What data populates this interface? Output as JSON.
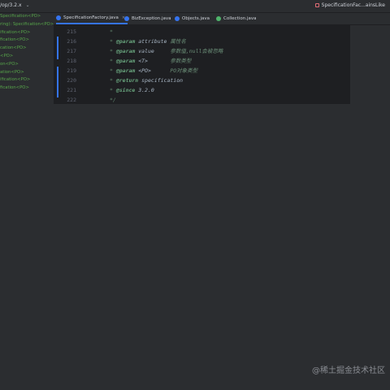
{
  "titlebar": {
    "branch": "/op/3.2.x",
    "branch_chevron": "⌄",
    "run_config": "SpecificationFac...ainsLike"
  },
  "left_panel": {
    "items": [
      "Specification<PO>",
      "ring): Specification<PO>",
      "ification<PO>",
      "fication<PO>",
      "cation<PO>",
      "<PO>",
      "on<PO>",
      "ation<PO>",
      "ification<PO>",
      "fication<PO>"
    ]
  },
  "tabs": [
    {
      "label": "SpecificationFactory.java",
      "icon": "class-icon",
      "color": "#3574f0",
      "active": true
    },
    {
      "label": "BizException.java",
      "icon": "class-icon",
      "color": "#3574f0"
    },
    {
      "label": "Objects.java",
      "icon": "class-icon",
      "color": "#3574f0"
    },
    {
      "label": "Collection.java",
      "icon": "interface-icon",
      "color": "#4fb56b"
    }
  ],
  "tab_close": "×",
  "editor": {
    "lines": [
      {
        "num": "215",
        "star": "*",
        "tag": "",
        "param": "",
        "desc": ""
      },
      {
        "num": "216",
        "star": "* ",
        "tag": "@param",
        "param": " attribute ",
        "desc": "属性名"
      },
      {
        "num": "217",
        "star": "* ",
        "tag": "@param",
        "param": " value     ",
        "desc": "参数值,null会被忽略"
      },
      {
        "num": "218",
        "star": "* ",
        "tag": "@param",
        "param": " <T>       ",
        "desc": "参数类型"
      },
      {
        "num": "219",
        "star": "* ",
        "tag": "@param",
        "param": " <PO>      ",
        "desc": "PO对象类型"
      },
      {
        "num": "220",
        "star": "* ",
        "tag": "@return",
        "param": " specification",
        "desc": ""
      },
      {
        "num": "221",
        "star": "* ",
        "tag": "@since",
        "param": " 3.2.0",
        "desc": ""
      },
      {
        "num": "222",
        "star": "*/",
        "tag": "",
        "param": "",
        "desc": ""
      }
    ]
  },
  "watermark": "@稀土掘金技术社区",
  "colors": {
    "background": "#2b2d30",
    "editor": "#1e1f22",
    "accent": "#3574f0",
    "doc_comment": "#5f826b",
    "left_panel_text": "#57a64a"
  }
}
